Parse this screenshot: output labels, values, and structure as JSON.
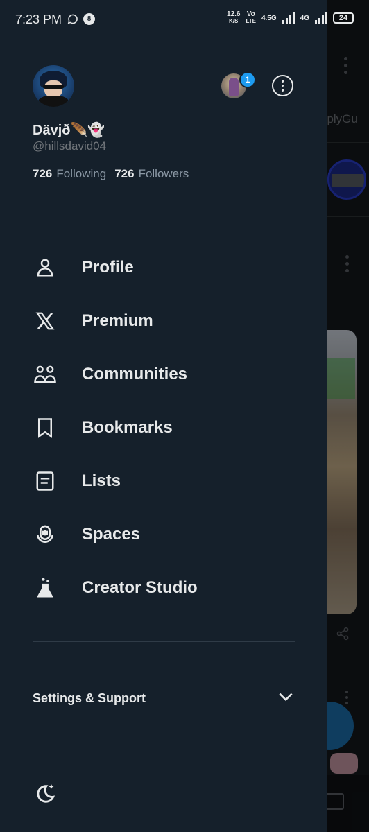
{
  "status_bar": {
    "time": "7:23 PM",
    "net_speed_value": "12.6",
    "net_speed_unit": "K/S",
    "volte_top": "Vo",
    "volte_bottom": "LTE",
    "network_1": "4.5G",
    "network_2": "4G",
    "battery": "24"
  },
  "background_app": {
    "peek_text": "eplyGu"
  },
  "profile": {
    "display_name": "Dävjð🪶👻",
    "handle": "@hillsdavid04",
    "following_count": "726",
    "following_label": "Following",
    "followers_count": "726",
    "followers_label": "Followers",
    "notification_badge": "1"
  },
  "menu": {
    "items": [
      {
        "label": "Profile",
        "icon": "person-icon"
      },
      {
        "label": "Premium",
        "icon": "x-logo-icon"
      },
      {
        "label": "Communities",
        "icon": "communities-icon"
      },
      {
        "label": "Bookmarks",
        "icon": "bookmark-icon"
      },
      {
        "label": "Lists",
        "icon": "list-icon"
      },
      {
        "label": "Spaces",
        "icon": "spaces-icon"
      },
      {
        "label": "Creator Studio",
        "icon": "flask-icon"
      }
    ]
  },
  "settings": {
    "label": "Settings & Support"
  },
  "colors": {
    "drawer_bg": "#15202b",
    "text_primary": "#e7e9ea",
    "text_secondary": "#71767b",
    "accent": "#1d9bf0"
  }
}
